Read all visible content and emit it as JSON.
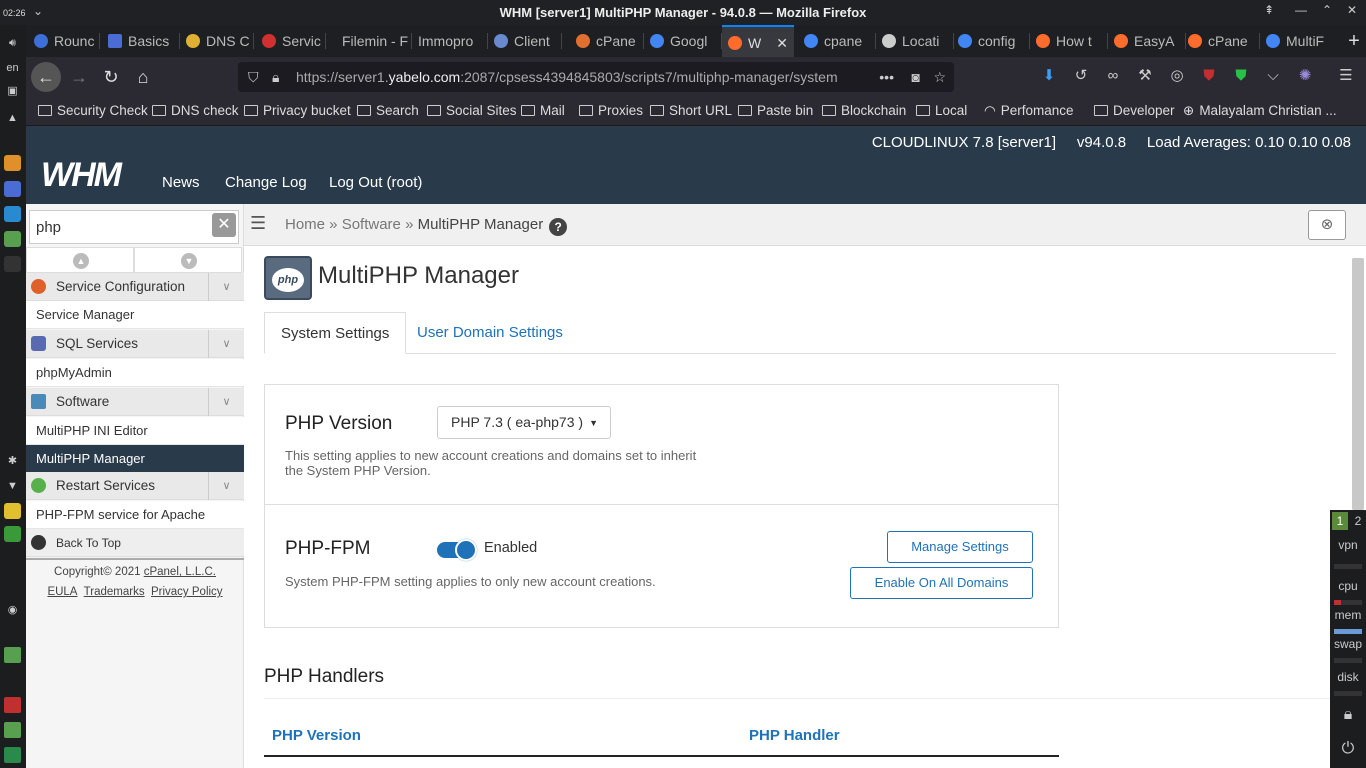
{
  "titlebar": {
    "time": "02:26",
    "title": "WHM [server1] MultiPHP Manager - 94.0.8 — Mozilla Firefox"
  },
  "tabs": [
    {
      "label": "Rounc",
      "color": "#3d6fd8"
    },
    {
      "label": "Basics",
      "color": "#4a6cd4"
    },
    {
      "label": "DNS C",
      "color": "#e0b030"
    },
    {
      "label": "Servic",
      "color": "#d03030"
    },
    {
      "label": "Filemin - F",
      "color": ""
    },
    {
      "label": "Immopro",
      "color": ""
    },
    {
      "label": "Client",
      "color": "#6a8ad0"
    },
    {
      "label": "cPane",
      "color": "#e07030"
    },
    {
      "label": "Googl",
      "color": "#4285f4"
    },
    {
      "label": "W",
      "color": "#ff6c2c"
    },
    {
      "label": "cpane",
      "color": "#4285f4"
    },
    {
      "label": "Locati",
      "color": "#ccc"
    },
    {
      "label": "config",
      "color": "#4285f4"
    },
    {
      "label": "How t",
      "color": "#ff6c2c"
    },
    {
      "label": "EasyA",
      "color": "#ff6c2c"
    },
    {
      "label": "cPane",
      "color": "#ff6c2c"
    },
    {
      "label": "MultiF",
      "color": "#4285f4"
    }
  ],
  "url": {
    "prefix": "https://server1.",
    "host": "yabelo.com",
    "rest": ":2087/cpsess4394845803/scripts7/multiphp-manager/system"
  },
  "bookmarks": [
    "Security Check",
    "DNS check",
    "Privacy bucket",
    "Search",
    "Social Sites",
    "Mail",
    "Proxies",
    "Short URL",
    "Paste bin",
    "Blockchain",
    "Local",
    "Perfomance",
    "Developer",
    "Malayalam Christian ..."
  ],
  "whm": {
    "info": "CLOUDLINUX 7.8 [server1]     v94.0.8     Load Averages: 0.10 0.10 0.08",
    "logo": "WHM",
    "nav": [
      "News",
      "Change Log",
      "Log Out (root)"
    ]
  },
  "sidebar": {
    "search_value": "php",
    "groups": [
      {
        "label": "Service Configuration",
        "color": "#e0602a",
        "items": [
          "Service Manager"
        ]
      },
      {
        "label": "SQL Services",
        "color": "#5a6ab0",
        "items": [
          "phpMyAdmin"
        ]
      },
      {
        "label": "Software",
        "color": "#4a8ab8",
        "items": [
          "MultiPHP INI Editor",
          "MultiPHP Manager"
        ]
      },
      {
        "label": "Restart Services",
        "color": "#58b04a",
        "items": [
          "PHP-FPM service for Apache"
        ]
      }
    ],
    "back_to_top": "Back To Top",
    "copyright": "Copyright© 2021",
    "company": "cPanel, L.L.C.",
    "links": [
      "EULA",
      "Trademarks",
      "Privacy Policy"
    ]
  },
  "breadcrumb": {
    "home": "Home",
    "software": "Software",
    "current": "MultiPHP Manager"
  },
  "page": {
    "title": "MultiPHP Manager",
    "icon_text": "php",
    "tabs": [
      "System Settings",
      "User Domain Settings"
    ],
    "php_version_label": "PHP Version",
    "php_version_value": "PHP 7.3 ( ea-php73 )",
    "php_version_desc": "This setting applies to new account creations and domains set to inherit the System PHP Version.",
    "fpm_label": "PHP-FPM",
    "fpm_state": "Enabled",
    "fpm_desc": "System PHP-FPM setting applies to only new account creations.",
    "manage_btn": "Manage Settings",
    "enable_all_btn": "Enable On All Domains",
    "handlers_title": "PHP Handlers",
    "col_version": "PHP Version",
    "col_handler": "PHP Handler"
  },
  "sysmon": {
    "desk1": "1",
    "desk2": "2",
    "labels": [
      "vpn",
      "cpu",
      "mem",
      "swap",
      "disk"
    ]
  }
}
